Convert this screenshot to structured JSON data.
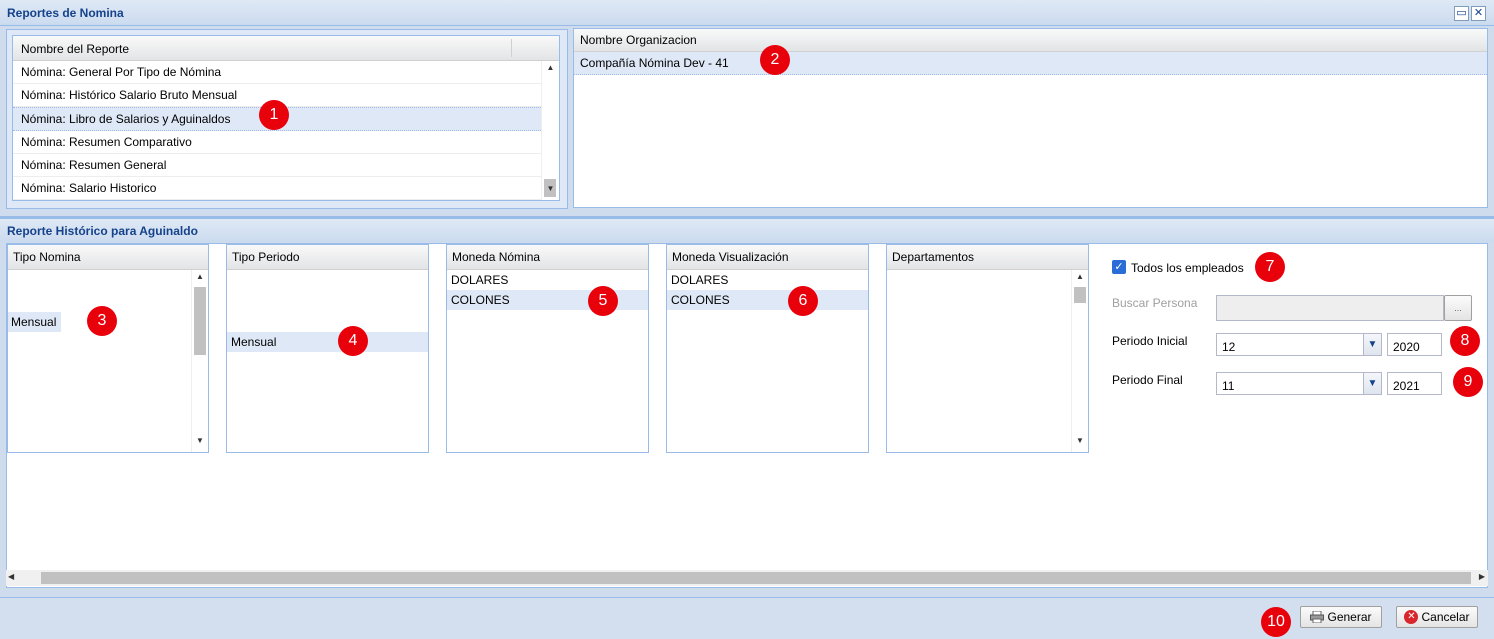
{
  "window": {
    "title": "Reportes de Nomina",
    "maximize_icon": "maximize-icon",
    "close_icon": "close-icon"
  },
  "report_grid": {
    "header": "Nombre del Reporte",
    "rows": [
      "Nómina: General Por Tipo de Nómina",
      "Nómina: Histórico Salario Bruto Mensual",
      "Nómina: Libro de Salarios y Aguinaldos",
      "Nómina: Resumen Comparativo",
      "Nómina: Resumen General",
      "Nómina: Salario Historico"
    ],
    "selected_index": 2
  },
  "org_grid": {
    "header": "Nombre Organizacion",
    "rows": [
      "Compañía Nómina Dev - 41"
    ]
  },
  "section": {
    "title": "Reporte Histórico para Aguinaldo"
  },
  "lists": {
    "tipo_nomina": {
      "header": "Tipo Nomina",
      "items": [
        "Mensual"
      ]
    },
    "tipo_periodo": {
      "header": "Tipo Periodo",
      "items": [
        "Mensual"
      ]
    },
    "moneda_nomina": {
      "header": "Moneda Nómina",
      "items": [
        "DOLARES",
        "COLONES"
      ],
      "selected": "COLONES"
    },
    "moneda_visualizacion": {
      "header": "Moneda Visualización",
      "items": [
        "DOLARES",
        "COLONES"
      ],
      "selected": "COLONES"
    },
    "departamentos": {
      "header": "Departamentos",
      "items": []
    }
  },
  "form": {
    "todos_label": "Todos los empleados",
    "todos_checked": true,
    "buscar_label": "Buscar Persona",
    "buscar_value": "",
    "buscar_button": "...",
    "periodo_inicial_label": "Periodo Inicial",
    "periodo_inicial_month": "12",
    "periodo_inicial_year": "2020",
    "periodo_final_label": "Periodo Final",
    "periodo_final_month": "11",
    "periodo_final_year": "2021"
  },
  "buttons": {
    "generar": "Generar",
    "cancelar": "Cancelar"
  },
  "badges": [
    "1",
    "2",
    "3",
    "4",
    "5",
    "6",
    "7",
    "8",
    "9",
    "10"
  ],
  "colors": {
    "badge": "#e8000b",
    "title": "#15428b",
    "selection": "#dfe8f6"
  }
}
